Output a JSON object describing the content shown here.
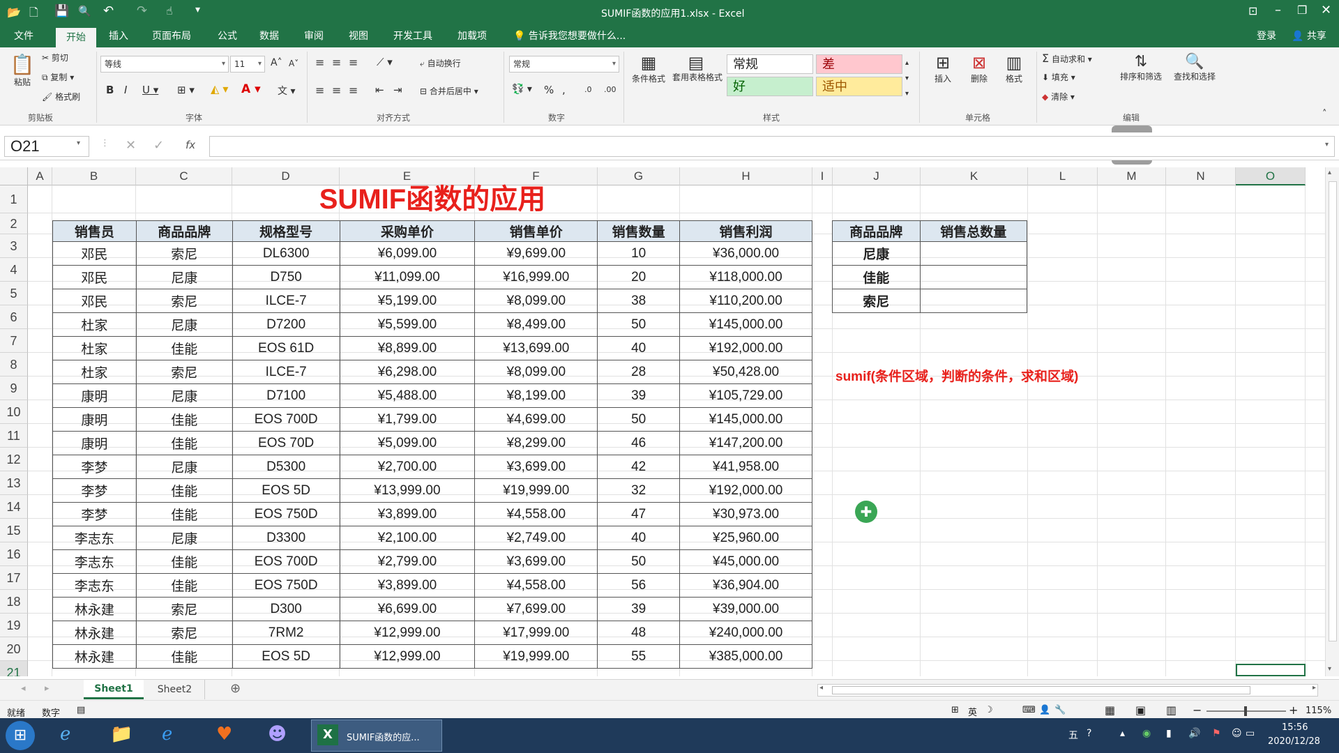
{
  "window": {
    "title": "SUMIF函数的应用1.xlsx - Excel",
    "login": "登录",
    "share": "共享"
  },
  "menu": {
    "items": [
      "文件",
      "开始",
      "插入",
      "页面布局",
      "公式",
      "数据",
      "审阅",
      "视图",
      "开发工具",
      "加载项"
    ],
    "active": "开始",
    "tell_me": "告诉我您想要做什么..."
  },
  "ribbon": {
    "clipboard": {
      "label": "剪贴板",
      "paste": "粘贴",
      "cut": "剪切",
      "copy": "复制",
      "format_painter": "格式刷"
    },
    "font": {
      "label": "字体",
      "name": "等线",
      "size": "11"
    },
    "alignment": {
      "label": "对齐方式",
      "wrap": "自动换行",
      "merge": "合并后居中"
    },
    "number": {
      "label": "数字",
      "format": "常规"
    },
    "styles": {
      "label": "样式",
      "cond_format": "条件格式",
      "table_format": "套用表格格式",
      "normal": "常规",
      "bad": "差",
      "good": "好",
      "neutral": "适中"
    },
    "cells": {
      "label": "单元格",
      "insert": "插入",
      "delete": "删除",
      "format": "格式"
    },
    "editing": {
      "label": "编辑",
      "autosum": "自动求和",
      "fill": "填充",
      "clear": "清除",
      "sort": "排序和筛选",
      "find": "查找和选择"
    }
  },
  "formula_bar": {
    "name_box": "O21",
    "formula": "",
    "fx": "fx"
  },
  "columns": [
    "A",
    "B",
    "C",
    "D",
    "E",
    "F",
    "G",
    "H",
    "I",
    "J",
    "K",
    "L",
    "M",
    "N",
    "O"
  ],
  "rows": [
    "1",
    "2",
    "3",
    "4",
    "5",
    "6",
    "7",
    "8",
    "9",
    "10",
    "11",
    "12",
    "13",
    "14",
    "15",
    "16",
    "17",
    "18",
    "19",
    "20",
    "21"
  ],
  "sheet": {
    "title": "SUMIF函数的应用",
    "headers": [
      "销售员",
      "商品品牌",
      "规格型号",
      "采购单价",
      "销售单价",
      "销售数量",
      "销售利润"
    ],
    "data": [
      [
        "邓民",
        "索尼",
        "DL6300",
        "¥6,099.00",
        "¥9,699.00",
        "10",
        "¥36,000.00"
      ],
      [
        "邓民",
        "尼康",
        "D750",
        "¥11,099.00",
        "¥16,999.00",
        "20",
        "¥118,000.00"
      ],
      [
        "邓民",
        "索尼",
        "ILCE-7",
        "¥5,199.00",
        "¥8,099.00",
        "38",
        "¥110,200.00"
      ],
      [
        "杜家",
        "尼康",
        "D7200",
        "¥5,599.00",
        "¥8,499.00",
        "50",
        "¥145,000.00"
      ],
      [
        "杜家",
        "佳能",
        "EOS 61D",
        "¥8,899.00",
        "¥13,699.00",
        "40",
        "¥192,000.00"
      ],
      [
        "杜家",
        "索尼",
        "ILCE-7",
        "¥6,298.00",
        "¥8,099.00",
        "28",
        "¥50,428.00"
      ],
      [
        "康明",
        "尼康",
        "D7100",
        "¥5,488.00",
        "¥8,199.00",
        "39",
        "¥105,729.00"
      ],
      [
        "康明",
        "佳能",
        "EOS 700D",
        "¥1,799.00",
        "¥4,699.00",
        "50",
        "¥145,000.00"
      ],
      [
        "康明",
        "佳能",
        "EOS 70D",
        "¥5,099.00",
        "¥8,299.00",
        "46",
        "¥147,200.00"
      ],
      [
        "李梦",
        "尼康",
        "D5300",
        "¥2,700.00",
        "¥3,699.00",
        "42",
        "¥41,958.00"
      ],
      [
        "李梦",
        "佳能",
        "EOS 5D",
        "¥13,999.00",
        "¥19,999.00",
        "32",
        "¥192,000.00"
      ],
      [
        "李梦",
        "佳能",
        "EOS 750D",
        "¥3,899.00",
        "¥4,558.00",
        "47",
        "¥30,973.00"
      ],
      [
        "李志东",
        "尼康",
        "D3300",
        "¥2,100.00",
        "¥2,749.00",
        "40",
        "¥25,960.00"
      ],
      [
        "李志东",
        "佳能",
        "EOS 700D",
        "¥2,799.00",
        "¥3,699.00",
        "50",
        "¥45,000.00"
      ],
      [
        "李志东",
        "佳能",
        "EOS 750D",
        "¥3,899.00",
        "¥4,558.00",
        "56",
        "¥36,904.00"
      ],
      [
        "林永建",
        "索尼",
        "D300",
        "¥6,699.00",
        "¥7,699.00",
        "39",
        "¥39,000.00"
      ],
      [
        "林永建",
        "索尼",
        "7RM2",
        "¥12,999.00",
        "¥17,999.00",
        "48",
        "¥240,000.00"
      ],
      [
        "林永建",
        "佳能",
        "EOS 5D",
        "¥12,999.00",
        "¥19,999.00",
        "55",
        "¥385,000.00"
      ]
    ],
    "summary_headers": [
      "商品品牌",
      "销售总数量"
    ],
    "summary_rows": [
      "尼康",
      "佳能",
      "索尼"
    ],
    "note": "sumif(条件区域，判断的条件，求和区域)"
  },
  "tabs": {
    "sheets": [
      "Sheet1",
      "Sheet2"
    ],
    "active": "Sheet1"
  },
  "status": {
    "ready": "就绪",
    "num": "数字",
    "zoom": "115%",
    "ime": [
      "英"
    ]
  },
  "taskbar": {
    "excel_task": "SUMIF函数的应...",
    "time": "15:56",
    "date": "2020/12/28"
  },
  "colors": {
    "excel_green": "#217346",
    "title_red": "#e8211c",
    "header_fill": "#dde7f0",
    "note_red": "#e8211c"
  }
}
